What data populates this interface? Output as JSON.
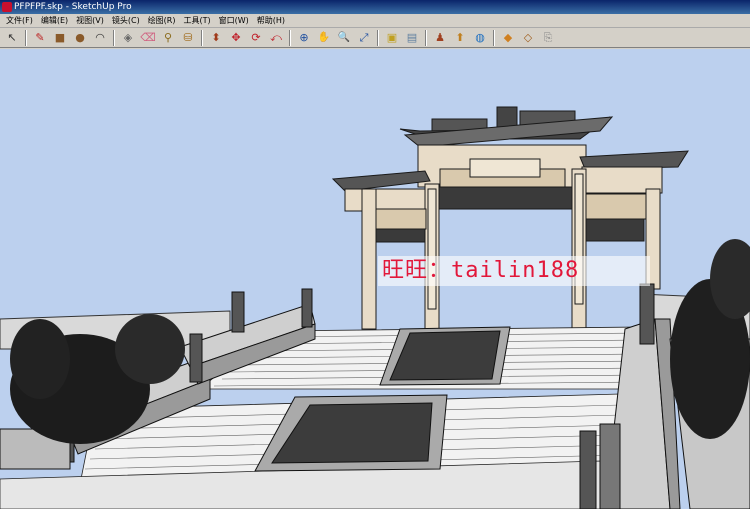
{
  "window": {
    "title": "PFPFPF.skp - SketchUp Pro"
  },
  "menu": {
    "items": [
      {
        "label": "文件(F)"
      },
      {
        "label": "编辑(E)"
      },
      {
        "label": "视图(V)"
      },
      {
        "label": "镜头(C)"
      },
      {
        "label": "绘图(R)"
      },
      {
        "label": "工具(T)"
      },
      {
        "label": "窗口(W)"
      },
      {
        "label": "帮助(H)"
      }
    ]
  },
  "toolbar": {
    "tools": [
      {
        "icon": "select-arrow-icon",
        "glyph": "↖"
      },
      {
        "icon": "pencil-icon",
        "glyph": "✎"
      },
      {
        "icon": "rectangle-icon",
        "glyph": "■"
      },
      {
        "icon": "circle-icon",
        "glyph": "●"
      },
      {
        "icon": "arc-icon",
        "glyph": "◠"
      },
      {
        "icon": "make-component-icon",
        "glyph": "◈"
      },
      {
        "icon": "eraser-icon",
        "glyph": "⌫"
      },
      {
        "icon": "tape-measure-icon",
        "glyph": "⚲"
      },
      {
        "icon": "paint-bucket-icon",
        "glyph": "⛁"
      },
      {
        "icon": "push-pull-icon",
        "glyph": "⬍"
      },
      {
        "icon": "move-icon",
        "glyph": "✥"
      },
      {
        "icon": "rotate-icon",
        "glyph": "⟳"
      },
      {
        "icon": "offset-icon",
        "glyph": "⤺"
      },
      {
        "icon": "orbit-icon",
        "glyph": "⊕"
      },
      {
        "icon": "pan-icon",
        "glyph": "✋"
      },
      {
        "icon": "zoom-icon",
        "glyph": "🔍"
      },
      {
        "icon": "zoom-extents-icon",
        "glyph": "⤢"
      },
      {
        "icon": "warehouse-get-models-icon",
        "glyph": "▣"
      },
      {
        "icon": "share-model-icon",
        "glyph": "▤"
      },
      {
        "icon": "component-icon",
        "glyph": "♟"
      },
      {
        "icon": "extension-icon",
        "glyph": "⬆"
      },
      {
        "icon": "earth-icon",
        "glyph": "◍"
      },
      {
        "icon": "materials-icon",
        "glyph": "◆"
      },
      {
        "icon": "styles-icon",
        "glyph": "◇"
      },
      {
        "icon": "layout-icon",
        "glyph": "⎘"
      }
    ]
  },
  "viewport": {
    "watermark": "旺旺：tailin188",
    "sky_color": "#bcd0ee",
    "watermark_color": "#e2173a"
  }
}
